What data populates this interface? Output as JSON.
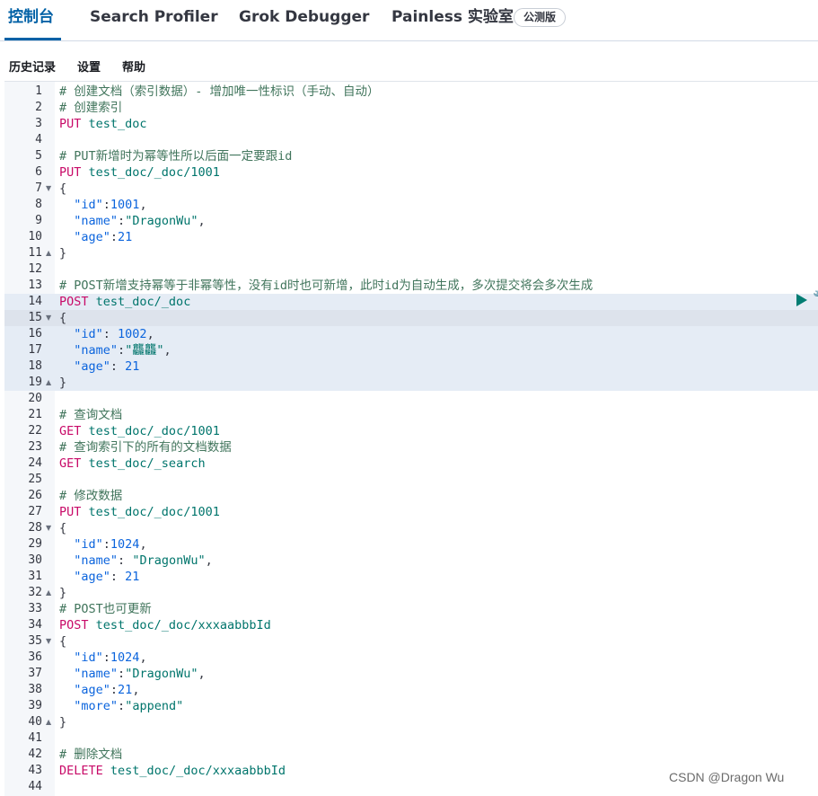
{
  "nav": {
    "tabs": [
      {
        "label": "控制台",
        "active": true
      },
      {
        "label": "Search Profiler",
        "active": false
      },
      {
        "label": "Grok Debugger",
        "active": false
      },
      {
        "label": "Painless 实验室",
        "active": false
      }
    ],
    "badge": "公测版"
  },
  "subnav": {
    "history": "历史记录",
    "settings": "设置",
    "help": "帮助"
  },
  "colors": {
    "accent": "#0061a6",
    "method": "#c80a68",
    "url": "#00756c",
    "comment": "#41755c",
    "key": "#0b64dd",
    "run_button": "#017d73"
  },
  "editor": {
    "lines": [
      {
        "n": "1",
        "t": [
          [
            "c",
            "# 创建文档（索引数据）- 增加唯一性标识（手动、自动）"
          ]
        ]
      },
      {
        "n": "2",
        "t": [
          [
            "c",
            "# 创建索引"
          ]
        ]
      },
      {
        "n": "3",
        "t": [
          [
            "m",
            "PUT"
          ],
          [
            "p",
            " "
          ],
          [
            "u",
            "test_doc"
          ]
        ]
      },
      {
        "n": "4",
        "t": []
      },
      {
        "n": "5",
        "t": [
          [
            "c",
            "# PUT新增时为幂等性所以后面一定要跟id"
          ]
        ]
      },
      {
        "n": "6",
        "t": [
          [
            "m",
            "PUT"
          ],
          [
            "p",
            " "
          ],
          [
            "u",
            "test_doc/_doc/1001"
          ]
        ]
      },
      {
        "n": "7",
        "fold": "▼",
        "t": [
          [
            "b",
            "{"
          ]
        ]
      },
      {
        "n": "8",
        "t": [
          [
            "p",
            "  "
          ],
          [
            "k",
            "\"id\""
          ],
          [
            "p",
            ":"
          ],
          [
            "v",
            "1001"
          ],
          [
            "p",
            ","
          ]
        ]
      },
      {
        "n": "9",
        "t": [
          [
            "p",
            "  "
          ],
          [
            "k",
            "\"name\""
          ],
          [
            "p",
            ":"
          ],
          [
            "s",
            "\"DragonWu\""
          ],
          [
            "p",
            ","
          ]
        ]
      },
      {
        "n": "10",
        "t": [
          [
            "p",
            "  "
          ],
          [
            "k",
            "\"age\""
          ],
          [
            "p",
            ":"
          ],
          [
            "v",
            "21"
          ]
        ]
      },
      {
        "n": "11",
        "fold": "▲",
        "t": [
          [
            "b",
            "}"
          ]
        ]
      },
      {
        "n": "12",
        "t": []
      },
      {
        "n": "13",
        "t": [
          [
            "c",
            "# POST新增支持幂等于非幂等性，没有id时也可新增，此时id为自动生成，多次提交将会多次生成"
          ]
        ]
      },
      {
        "n": "14",
        "t": [
          [
            "m",
            "POST"
          ],
          [
            "p",
            " "
          ],
          [
            "u",
            "test_doc/_doc"
          ]
        ]
      },
      {
        "n": "15",
        "fold": "▼",
        "t": [
          [
            "b",
            "{"
          ]
        ]
      },
      {
        "n": "16",
        "t": [
          [
            "p",
            "  "
          ],
          [
            "k",
            "\"id\""
          ],
          [
            "p",
            ": "
          ],
          [
            "v",
            "1002"
          ],
          [
            "p",
            ","
          ]
        ]
      },
      {
        "n": "17",
        "t": [
          [
            "p",
            "  "
          ],
          [
            "k",
            "\"name\""
          ],
          [
            "p",
            ":"
          ],
          [
            "s",
            "\"龘龘\""
          ],
          [
            "p",
            ","
          ]
        ]
      },
      {
        "n": "18",
        "t": [
          [
            "p",
            "  "
          ],
          [
            "k",
            "\"age\""
          ],
          [
            "p",
            ": "
          ],
          [
            "v",
            "21"
          ]
        ]
      },
      {
        "n": "19",
        "fold": "▲",
        "t": [
          [
            "b",
            "}"
          ]
        ]
      },
      {
        "n": "20",
        "t": []
      },
      {
        "n": "21",
        "t": [
          [
            "c",
            "# 查询文档"
          ]
        ]
      },
      {
        "n": "22",
        "t": [
          [
            "m",
            "GET"
          ],
          [
            "p",
            " "
          ],
          [
            "u",
            "test_doc/_doc/1001"
          ]
        ]
      },
      {
        "n": "23",
        "t": [
          [
            "c",
            "# 查询索引下的所有的文档数据"
          ]
        ]
      },
      {
        "n": "24",
        "t": [
          [
            "m",
            "GET"
          ],
          [
            "p",
            " "
          ],
          [
            "u",
            "test_doc/_search"
          ]
        ]
      },
      {
        "n": "25",
        "t": []
      },
      {
        "n": "26",
        "t": [
          [
            "c",
            "# 修改数据"
          ]
        ]
      },
      {
        "n": "27",
        "t": [
          [
            "m",
            "PUT"
          ],
          [
            "p",
            " "
          ],
          [
            "u",
            "test_doc/_doc/1001"
          ]
        ]
      },
      {
        "n": "28",
        "fold": "▼",
        "t": [
          [
            "b",
            "{"
          ]
        ]
      },
      {
        "n": "29",
        "t": [
          [
            "p",
            "  "
          ],
          [
            "k",
            "\"id\""
          ],
          [
            "p",
            ":"
          ],
          [
            "v",
            "1024"
          ],
          [
            "p",
            ","
          ]
        ]
      },
      {
        "n": "30",
        "t": [
          [
            "p",
            "  "
          ],
          [
            "k",
            "\"name\""
          ],
          [
            "p",
            ": "
          ],
          [
            "s",
            "\"DragonWu\""
          ],
          [
            "p",
            ","
          ]
        ]
      },
      {
        "n": "31",
        "t": [
          [
            "p",
            "  "
          ],
          [
            "k",
            "\"age\""
          ],
          [
            "p",
            ": "
          ],
          [
            "v",
            "21"
          ]
        ]
      },
      {
        "n": "32",
        "fold": "▲",
        "t": [
          [
            "b",
            "}"
          ]
        ]
      },
      {
        "n": "33",
        "t": [
          [
            "c",
            "# POST也可更新"
          ]
        ]
      },
      {
        "n": "34",
        "t": [
          [
            "m",
            "POST"
          ],
          [
            "p",
            " "
          ],
          [
            "u",
            "test_doc/_doc/xxxaabbbId"
          ]
        ]
      },
      {
        "n": "35",
        "fold": "▼",
        "t": [
          [
            "b",
            "{"
          ]
        ]
      },
      {
        "n": "36",
        "t": [
          [
            "p",
            "  "
          ],
          [
            "k",
            "\"id\""
          ],
          [
            "p",
            ":"
          ],
          [
            "v",
            "1024"
          ],
          [
            "p",
            ","
          ]
        ]
      },
      {
        "n": "37",
        "t": [
          [
            "p",
            "  "
          ],
          [
            "k",
            "\"name\""
          ],
          [
            "p",
            ":"
          ],
          [
            "s",
            "\"DragonWu\""
          ],
          [
            "p",
            ","
          ]
        ]
      },
      {
        "n": "38",
        "t": [
          [
            "p",
            "  "
          ],
          [
            "k",
            "\"age\""
          ],
          [
            "p",
            ":"
          ],
          [
            "v",
            "21"
          ],
          [
            "p",
            ","
          ]
        ]
      },
      {
        "n": "39",
        "t": [
          [
            "p",
            "  "
          ],
          [
            "k",
            "\"more\""
          ],
          [
            "p",
            ":"
          ],
          [
            "s",
            "\"append\""
          ]
        ]
      },
      {
        "n": "40",
        "fold": "▲",
        "t": [
          [
            "b",
            "}"
          ]
        ]
      },
      {
        "n": "41",
        "t": []
      },
      {
        "n": "42",
        "t": [
          [
            "c",
            "# 删除文档"
          ]
        ]
      },
      {
        "n": "43",
        "t": [
          [
            "m",
            "DELETE"
          ],
          [
            "p",
            " "
          ],
          [
            "u",
            "test_doc/_doc/xxxaabbbId"
          ]
        ]
      },
      {
        "n": "44",
        "t": []
      }
    ]
  },
  "watermark": "CSDN @Dragon   Wu"
}
